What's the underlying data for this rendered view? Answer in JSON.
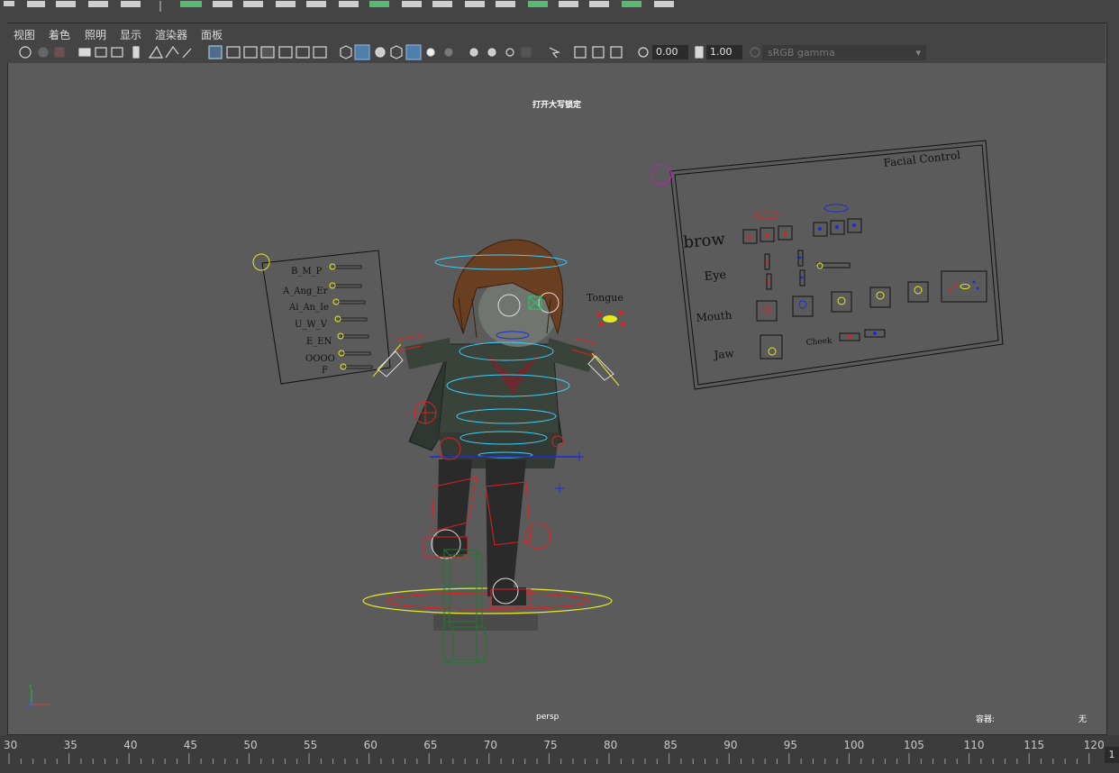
{
  "menubar": {
    "items": [
      "视图",
      "着色",
      "照明",
      "显示",
      "渲染器",
      "面板"
    ]
  },
  "toolbar": {
    "exposure_value": "0.00",
    "gamma_value": "1.00",
    "color_space": "sRGB gamma"
  },
  "viewport": {
    "hud_caps_lock": "打开大写锁定",
    "camera_name": "persp",
    "camera_label": "容器:",
    "camera_value": "无"
  },
  "rig": {
    "facial_title": "Facial Control",
    "brow": "brow",
    "eye": "Eye",
    "mouth": "Mouth",
    "jaw": "Jaw",
    "cheek": "Cheek",
    "tongue": "Tongue",
    "phonemes": [
      "B_M_P",
      "A_Ang_Er",
      "Ai_An_Ie",
      "U_W_V",
      "E_EN",
      "OOOO",
      "F"
    ]
  },
  "timeline": {
    "ticks": [
      "30",
      "35",
      "40",
      "45",
      "50",
      "55",
      "60",
      "65",
      "70",
      "75",
      "80",
      "85",
      "90",
      "95",
      "100",
      "105",
      "110",
      "115",
      "120"
    ],
    "current_frame": "1"
  },
  "colors": {
    "viewport_bg": "#5b5b5b",
    "ui_bg": "#444444",
    "control_red": "#e02020",
    "control_blue": "#1a2cd8",
    "control_yellow": "#e8e820",
    "control_cyan": "#3ad0ff",
    "control_green": "#1e7a2c"
  }
}
